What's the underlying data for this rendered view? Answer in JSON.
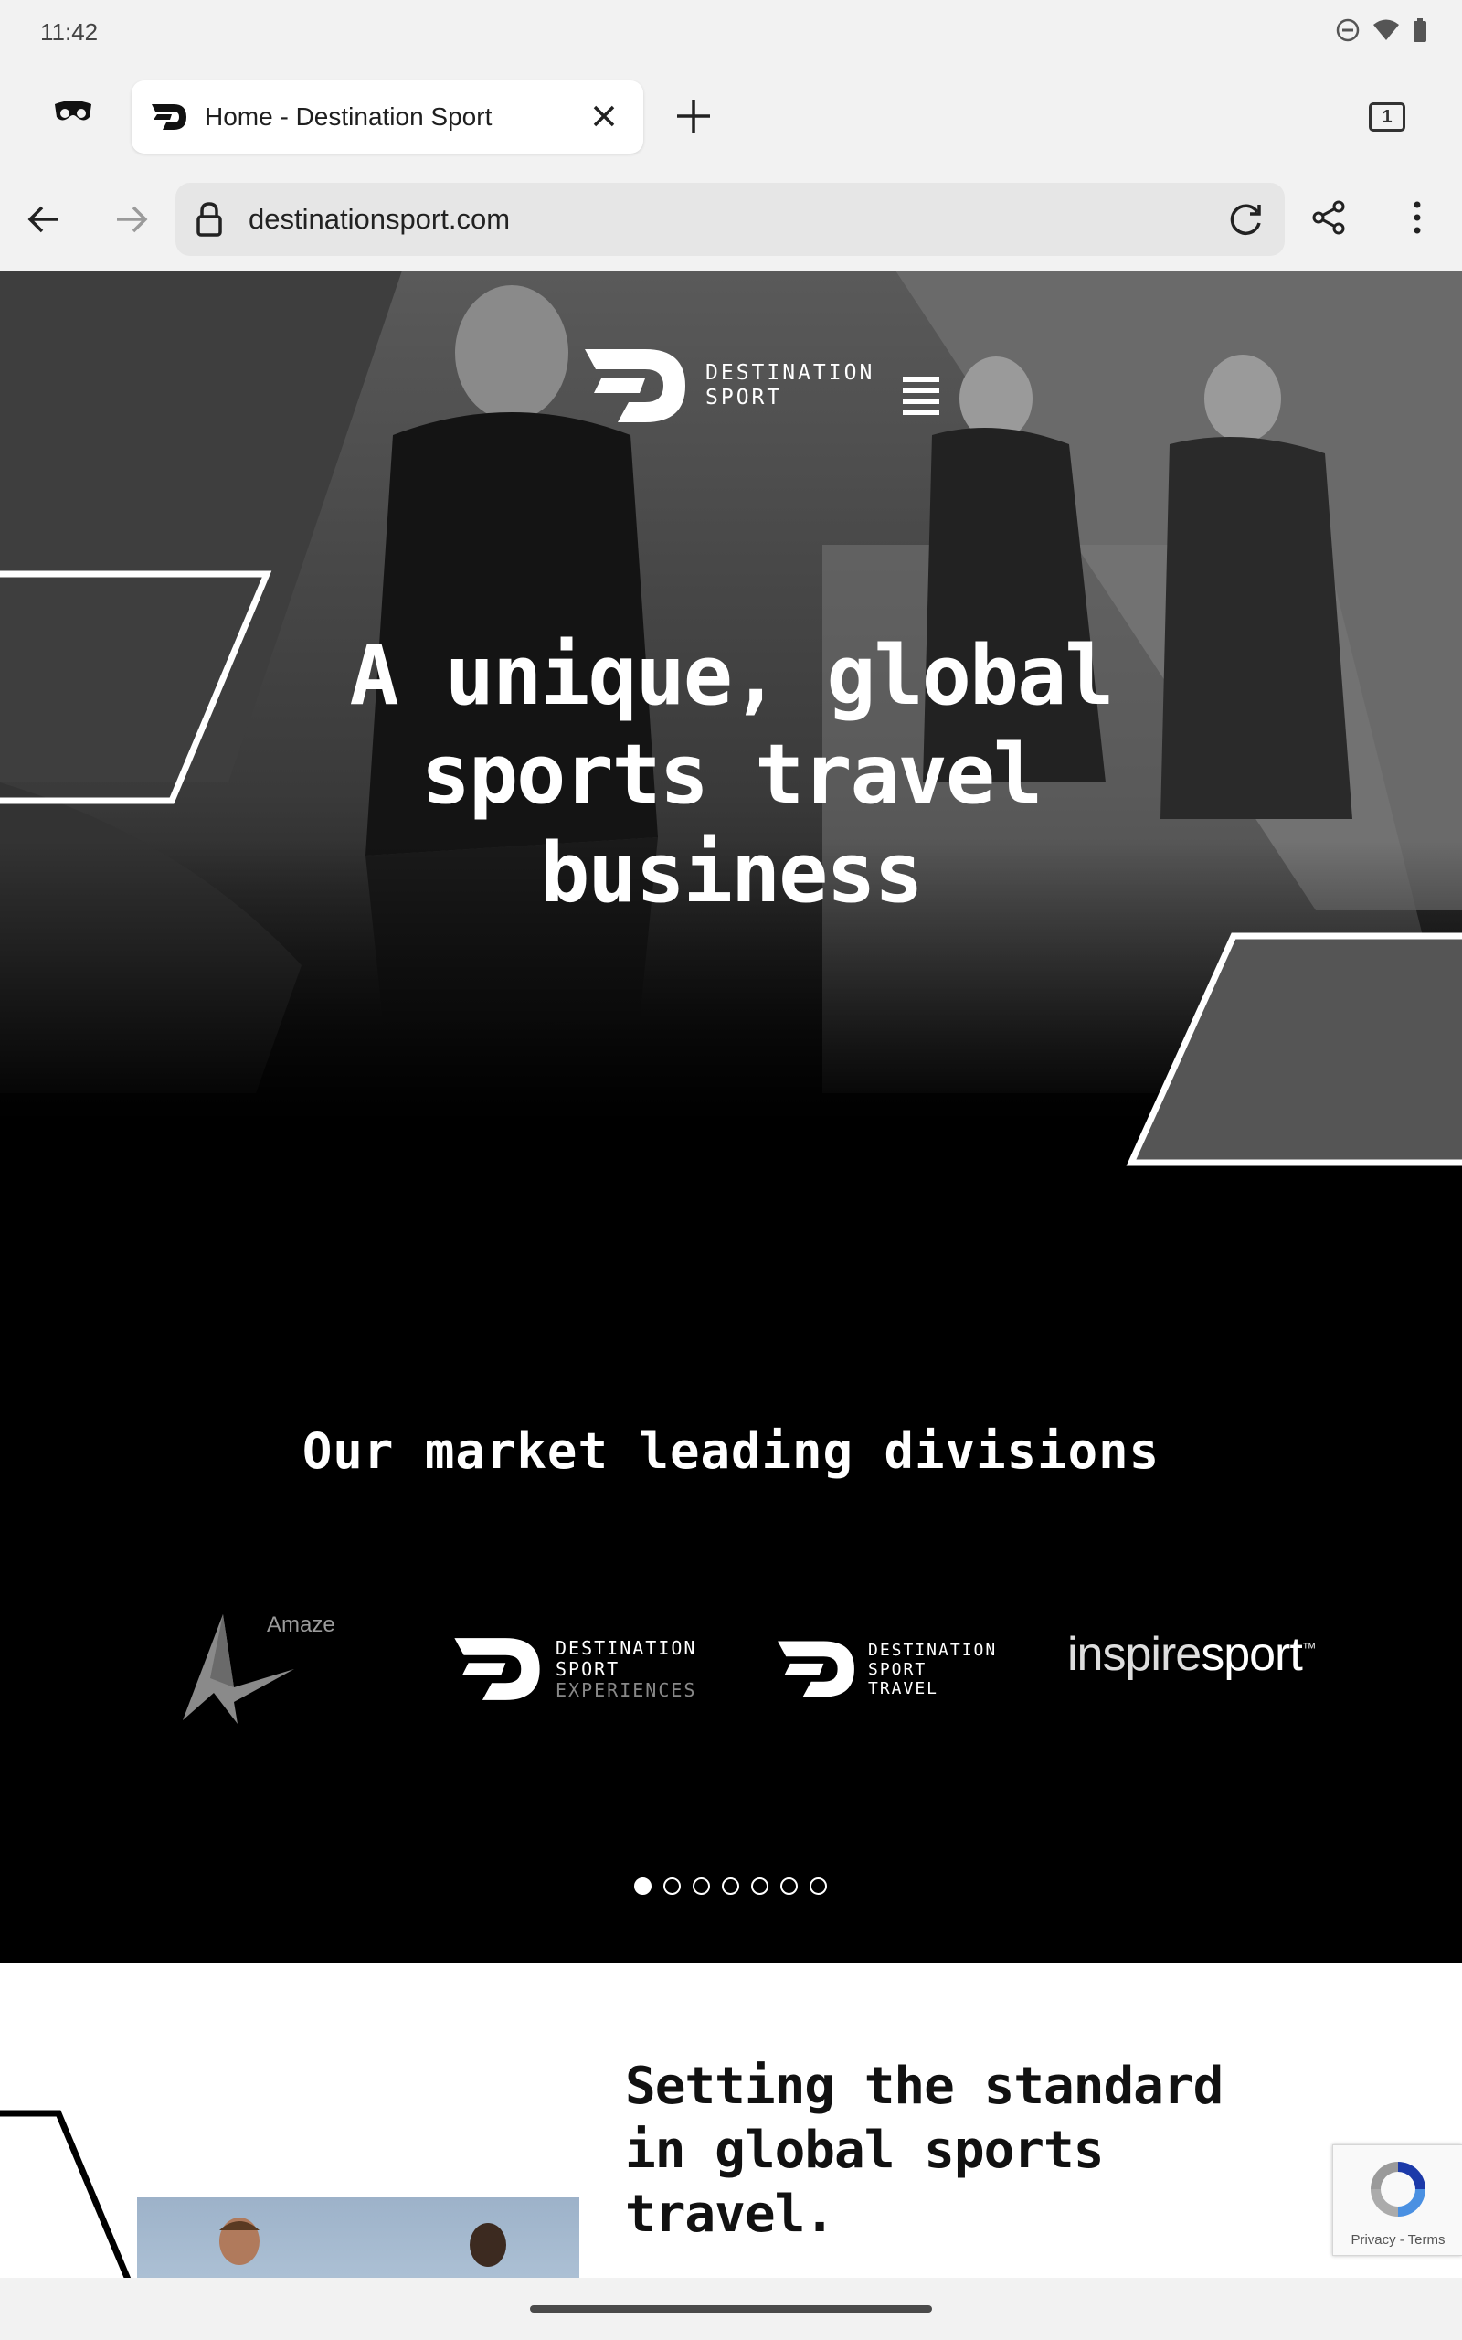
{
  "status": {
    "time": "11:42"
  },
  "tab": {
    "title": "Home - Destination Sport",
    "count": "1"
  },
  "toolbar": {
    "url": "destinationsport.com"
  },
  "hero": {
    "logo_line1": "DESTINATION",
    "logo_line2": "SPORT",
    "title_line1": "A unique, global",
    "title_line2": "sports travel",
    "title_line3": "business"
  },
  "divisions": {
    "heading": "Our market leading divisions",
    "brands": [
      {
        "name": "Amaze"
      },
      {
        "line1": "DESTINATION",
        "line2": "SPORT",
        "line3": "EXPERIENCES"
      },
      {
        "line1": "DESTINATION",
        "line2": "SPORT",
        "line3": "TRAVEL"
      },
      {
        "prefix": "inspire",
        "suffix": "sport",
        "tm": "™"
      }
    ],
    "carousel_pages": 7,
    "carousel_active": 1
  },
  "standard": {
    "line1": "Setting the standard",
    "line2": "in global sports",
    "line3": "travel."
  },
  "recaptcha": {
    "links": "Privacy - Terms"
  },
  "colors": {
    "hero_bg": "#000000",
    "accent": "#ffffff",
    "text_dark": "#111111"
  }
}
